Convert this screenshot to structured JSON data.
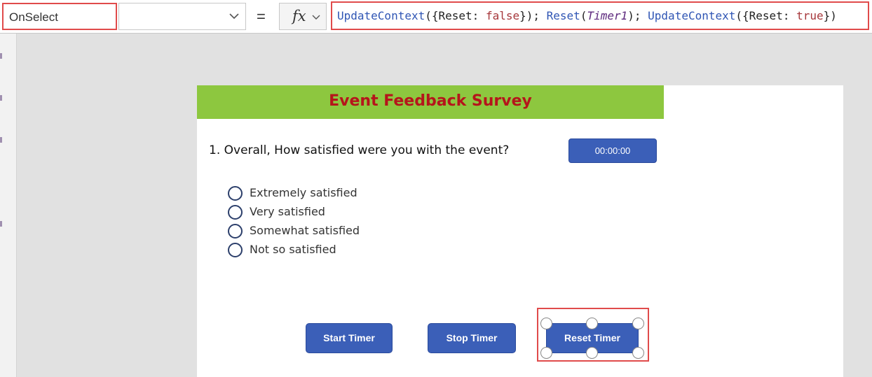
{
  "formula_bar": {
    "property": "OnSelect",
    "dropdown_value": "",
    "equals": "=",
    "fx_label": "fx",
    "formula": {
      "f1": "UpdateContext",
      "p1": "({Reset: ",
      "v1": "false",
      "p2": "}); ",
      "f2": "Reset",
      "p3": "(",
      "r1": "Timer1",
      "p4": "); ",
      "f3": "UpdateContext",
      "p5": "({Reset: ",
      "v2": "true",
      "p6": "})"
    }
  },
  "screen": {
    "title": "Event Feedback Survey",
    "question": "1. Overall, How satisfied were you with the event?",
    "timer": "00:00:00",
    "options": [
      "Extremely satisfied",
      "Very satisfied",
      "Somewhat satisfied",
      "Not so satisfied"
    ],
    "buttons": {
      "start": "Start Timer",
      "stop": "Stop Timer",
      "reset": "Reset Timer"
    }
  },
  "colors": {
    "accent_button": "#3b5fb8",
    "banner": "#8dc73f",
    "title": "#b5151b",
    "highlight": "#e04b4b"
  }
}
